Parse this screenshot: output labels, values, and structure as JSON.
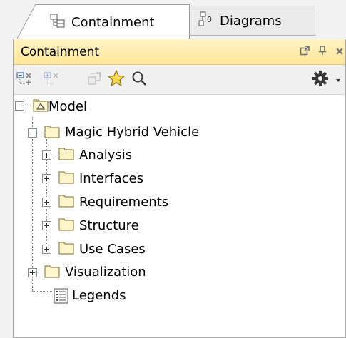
{
  "tabs": [
    {
      "label": "Containment",
      "icon": "containment-icon",
      "active": true
    },
    {
      "label": "Diagrams",
      "icon": "diagrams-icon",
      "active": false
    }
  ],
  "panel": {
    "title": "Containment",
    "header_buttons": [
      "undock-icon",
      "pin-icon",
      "close-icon"
    ],
    "toolbar": [
      "collapse-all-icon",
      "expand-all-icon",
      "open-icon",
      "favorite-star-icon",
      "search-icon",
      "gear-icon",
      "dropdown-arrow-icon"
    ]
  },
  "tree": {
    "root": "Model",
    "project": "Magic Hybrid Vehicle",
    "project_children": [
      "Analysis",
      "Interfaces",
      "Requirements",
      "Structure",
      "Use Cases"
    ],
    "visualization": "Visualization",
    "legends": "Legends"
  },
  "colors": {
    "header_bg": "#ffe69a",
    "folder_fill": "#fff6cc",
    "folder_stroke": "#7d6a2c",
    "gear": "#3a3a3a",
    "star": "#f3c400"
  }
}
